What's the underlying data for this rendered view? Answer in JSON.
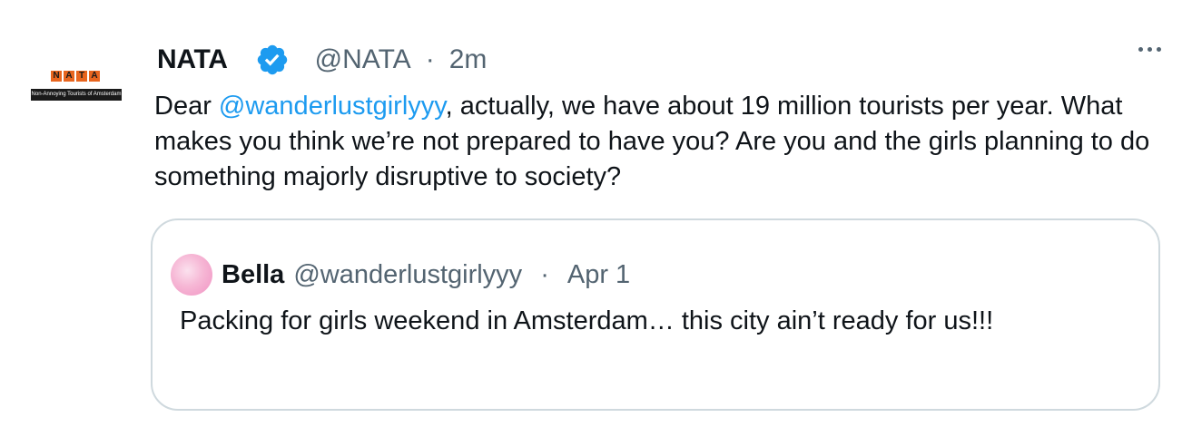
{
  "tweet": {
    "avatar": {
      "logo_letters": [
        "N",
        "A",
        "T",
        "A"
      ],
      "logo_subtitle": "Non-Annoying Tourists of Amsterdam"
    },
    "display_name": "NATA",
    "verified_icon": "verified-badge-icon",
    "handle": "@NATA",
    "separator": "·",
    "timestamp": "2m",
    "more_icon": "more-options-icon",
    "text": {
      "prefix": "Dear ",
      "mention": "@wanderlustgirlyyy",
      "body": ", actually, we have about 19 million tourists per year. What makes you think we’re not prepared to have you? Are you and the girls planning to do something majorly disruptive to society?"
    }
  },
  "quote": {
    "display_name": "Bella",
    "handle": "@wanderlustgirlyyy",
    "separator": "·",
    "timestamp": "Apr 1",
    "text": "Packing for girls weekend in Amsterdam… this city ain’t ready for us!!!"
  },
  "colors": {
    "link": "#1d9bf0",
    "secondary_text": "#536471",
    "primary_text": "#0f1419",
    "border": "#cfd9de",
    "logo_orange": "#e8651e"
  }
}
